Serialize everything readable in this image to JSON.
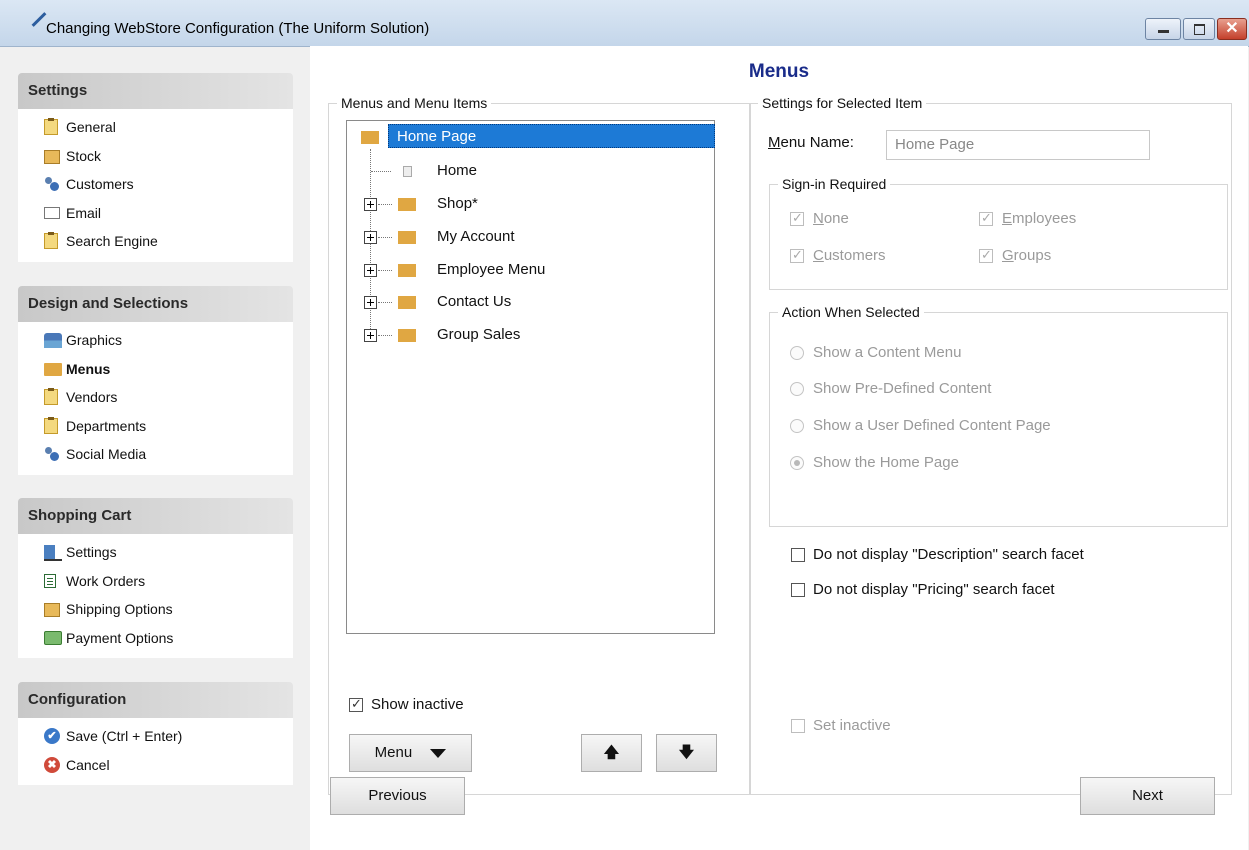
{
  "window": {
    "title": "Changing WebStore Configuration  (The Uniform Solution)",
    "close_glyph": "✕"
  },
  "sidebar": {
    "sections": [
      {
        "title": "Settings",
        "items": [
          {
            "label": "General",
            "icon": "clipboard-icon"
          },
          {
            "label": "Stock",
            "icon": "box-icon"
          },
          {
            "label": "Customers",
            "icon": "people-icon"
          },
          {
            "label": "Email",
            "icon": "email-icon"
          },
          {
            "label": "Search Engine",
            "icon": "clipboard-icon"
          }
        ]
      },
      {
        "title": "Design and Selections",
        "items": [
          {
            "label": "Graphics",
            "icon": "storefront-icon"
          },
          {
            "label": "Menus",
            "icon": "folder-icon",
            "selected": true
          },
          {
            "label": "Vendors",
            "icon": "clipboard-icon"
          },
          {
            "label": "Departments",
            "icon": "clipboard-icon"
          },
          {
            "label": "Social Media",
            "icon": "people-icon"
          }
        ]
      },
      {
        "title": "Shopping Cart",
        "items": [
          {
            "label": "Settings",
            "icon": "cart-icon"
          },
          {
            "label": "Work Orders",
            "icon": "document-icon"
          },
          {
            "label": "Shipping Options",
            "icon": "box-icon"
          },
          {
            "label": "Payment Options",
            "icon": "payment-icon"
          }
        ]
      },
      {
        "title": "Configuration",
        "items": [
          {
            "label": "Save (Ctrl + Enter)",
            "icon": "check-circle-icon",
            "glyph": "✔"
          },
          {
            "label": "Cancel",
            "icon": "cancel-circle-icon",
            "glyph": "✖"
          }
        ]
      }
    ]
  },
  "main": {
    "title": "Menus",
    "menus_group": {
      "legend": "Menus and Menu Items",
      "tree": [
        {
          "label": "Home Page",
          "selected": true,
          "type": "folder"
        },
        {
          "label": "Home",
          "type": "page"
        },
        {
          "label": "Shop*",
          "type": "folder",
          "expandable": true
        },
        {
          "label": "My Account",
          "type": "folder",
          "expandable": true
        },
        {
          "label": "Employee Menu",
          "type": "folder",
          "expandable": true
        },
        {
          "label": "Contact Us",
          "type": "folder",
          "expandable": true
        },
        {
          "label": "Group Sales",
          "type": "folder",
          "expandable": true
        }
      ],
      "show_inactive": {
        "label": "Show inactive",
        "checked": true
      },
      "menu_button": "Menu",
      "up_glyph": "🡅",
      "down_glyph": "🡇"
    },
    "settings_group": {
      "legend": "Settings for Selected Item",
      "menu_name_label_first": "M",
      "menu_name_label_rest": "enu Name:",
      "menu_name_value": "Home Page",
      "signin": {
        "legend": "Sign-in Required",
        "none": {
          "first": "N",
          "rest": "one",
          "checked": true
        },
        "employees": {
          "first": "E",
          "rest": "mployees",
          "checked": true
        },
        "customers": {
          "first": "C",
          "rest": "ustomers",
          "checked": true
        },
        "groups": {
          "first": "G",
          "rest": "roups",
          "checked": true
        }
      },
      "action": {
        "legend": "Action When Selected",
        "options": [
          {
            "label": "Show a Content Menu",
            "selected": false
          },
          {
            "label": "Show Pre-Defined Content",
            "selected": false
          },
          {
            "label": "Show a User Defined Content Page",
            "selected": false
          },
          {
            "label": "Show the Home Page",
            "selected": true
          }
        ]
      },
      "no_description_facet": {
        "label": "Do not display \"Description\" search facet",
        "checked": false
      },
      "no_pricing_facet": {
        "label": "Do not display \"Pricing\" search facet",
        "checked": false
      },
      "set_inactive": {
        "label": "Set inactive",
        "checked": false
      }
    },
    "previous_button": "Previous",
    "next_button": "Next"
  }
}
